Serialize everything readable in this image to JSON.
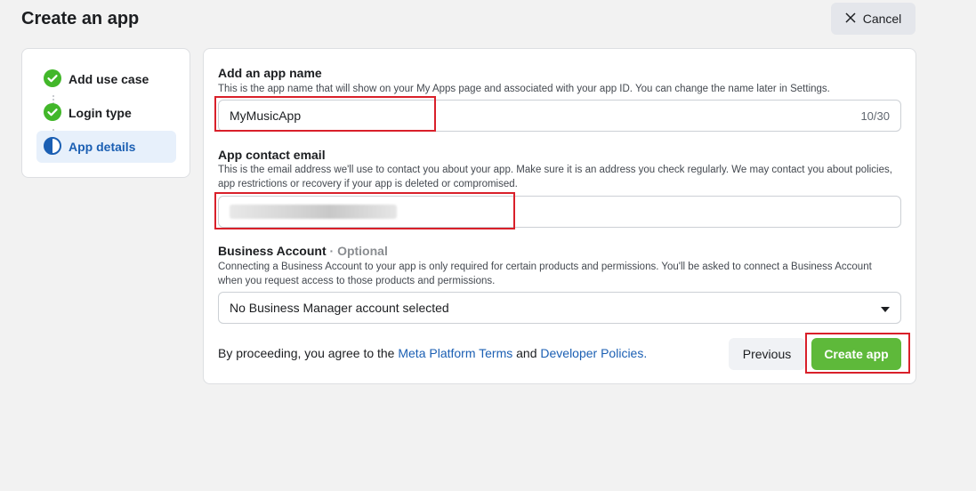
{
  "header": {
    "title": "Create an app",
    "cancel_label": "Cancel"
  },
  "steps": [
    {
      "label": "Add use case",
      "status": "complete"
    },
    {
      "label": "Login type",
      "status": "complete"
    },
    {
      "label": "App details",
      "status": "current"
    }
  ],
  "form": {
    "app_name": {
      "label": "Add an app name",
      "help": "This is the app name that will show on your My Apps page and associated with your app ID. You can change the name later in Settings.",
      "value": "MyMusicApp",
      "counter": "10/30"
    },
    "contact_email": {
      "label": "App contact email",
      "help": "This is the email address we'll use to contact you about your app. Make sure it is an address you check regularly. We may contact you about policies, app restrictions or recovery if your app is deleted or compromised."
    },
    "business_account": {
      "label": "Business Account",
      "optional": "· Optional",
      "help": "Connecting a Business Account to your app is only required for certain products and permissions. You'll be asked to connect a Business Account when you request access to those products and permissions.",
      "selected": "No Business Manager account selected"
    }
  },
  "footer": {
    "terms_prefix": "By proceeding, you agree to the ",
    "terms_link": "Meta Platform Terms",
    "terms_mid": " and ",
    "policies_link": "Developer Policies.",
    "previous_label": "Previous",
    "create_label": "Create app"
  },
  "colors": {
    "accent": "#1b5fb3",
    "success": "#42b72a",
    "create_button": "#5eb93a",
    "highlight": "#d9202a"
  }
}
